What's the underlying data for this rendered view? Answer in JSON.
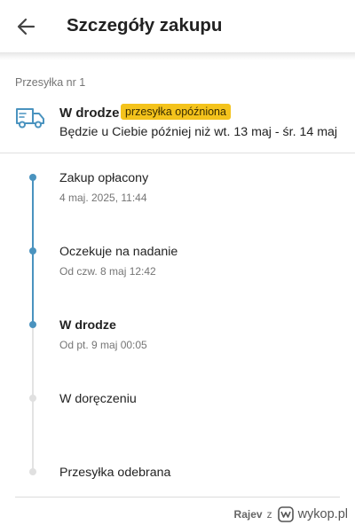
{
  "header": {
    "title": "Szczegóły zakupu"
  },
  "shipment": {
    "label": "Przesyłka nr 1",
    "status": "W drodze",
    "badge": "przesyłka opóźniona",
    "eta": "Będzie u Ciebie później niż wt. 13 maj - śr. 14 maj"
  },
  "timeline": [
    {
      "title": "Zakup opłacony",
      "date": "4 maj. 2025, 11:44",
      "state": "done"
    },
    {
      "title": "Oczekuje na nadanie",
      "date": "Od czw. 8 maj 12:42",
      "state": "done"
    },
    {
      "title": "W drodze",
      "date": "Od pt. 9 maj 00:05",
      "state": "current"
    },
    {
      "title": "W doręczeniu",
      "date": "",
      "state": "pending"
    },
    {
      "title": "Przesyłka odebrana",
      "date": "",
      "state": "pending"
    }
  ],
  "watermark": {
    "author": "Rajev",
    "z": "z",
    "site": "wykop.pl"
  },
  "colors": {
    "accent": "#4a93bf",
    "badge": "#f4c31c",
    "inactive": "#e0e0e0"
  }
}
